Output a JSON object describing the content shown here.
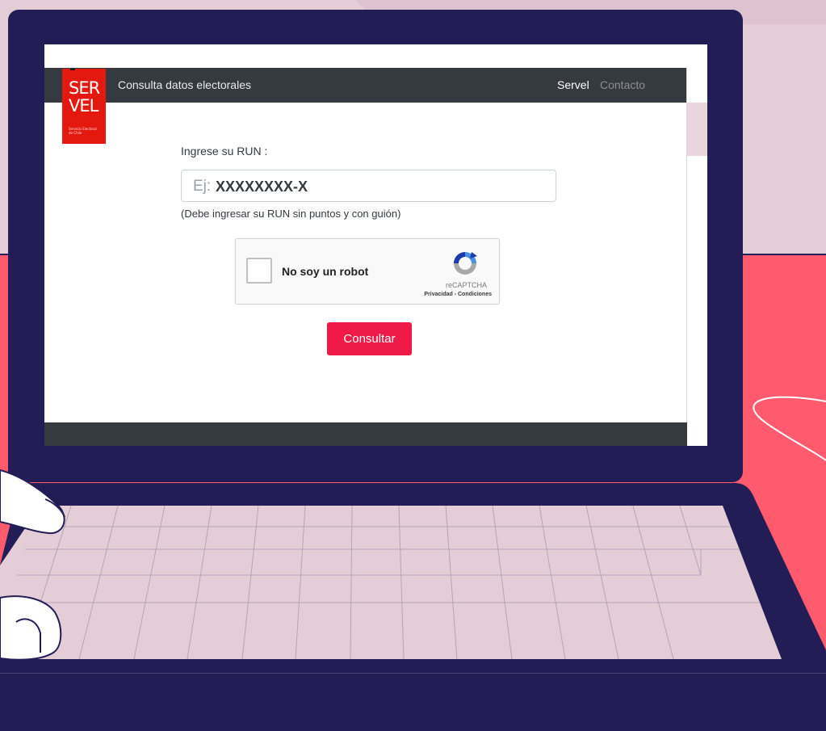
{
  "colors": {
    "background": "#e5cdd8",
    "accent_red": "#ff5a6e",
    "laptop_navy": "#221e55",
    "navbar": "#343a40",
    "logo_red": "#e3190f",
    "button_red": "#ef1a48"
  },
  "logo": {
    "line1": "SER",
    "line2": "VEL",
    "subtitle": "Servicio Electoral de Chile",
    "icon": "servel-logo"
  },
  "navbar": {
    "brand": "Consulta datos electorales",
    "links": [
      "Servel",
      "Contacto"
    ]
  },
  "form": {
    "run_label": "Ingrese su RUN :",
    "placeholder_prefix": "Ej:",
    "placeholder_example": "XXXXXXXX-X",
    "hint": "(Debe ingresar su RUN sin puntos y con guión)",
    "submit_label": "Consultar"
  },
  "recaptcha": {
    "label": "No soy un robot",
    "brand": "reCAPTCHA",
    "links": "Privacidad - Condiciones",
    "icon": "recaptcha-icon"
  }
}
